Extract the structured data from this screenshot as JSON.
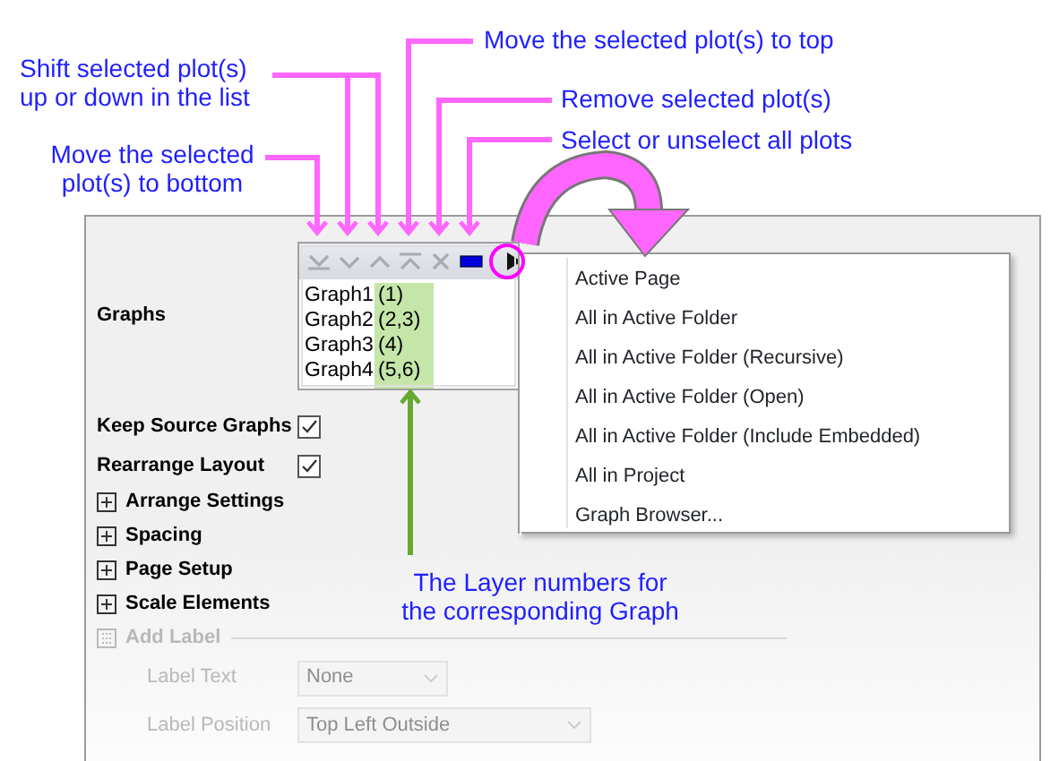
{
  "callouts": [
    {
      "kind": "shift",
      "text": "Shift selected plot(s)\nup or down in the list"
    },
    {
      "kind": "bottom",
      "text": "Move the selected\nplot(s) to bottom"
    },
    {
      "kind": "top",
      "text": "Move the selected plot(s) to top"
    },
    {
      "kind": "remove",
      "text": "Remove selected plot(s)"
    },
    {
      "kind": "select",
      "text": "Select or unselect all plots"
    },
    {
      "kind": "layers",
      "text": "The Layer numbers for\n the corresponding Graph"
    }
  ],
  "dialog": {
    "graphs_label": "Graphs",
    "toolbar": [
      {
        "kind": "bottom",
        "disabled": true
      },
      {
        "kind": "down",
        "disabled": true
      },
      {
        "kind": "up",
        "disabled": true
      },
      {
        "kind": "top",
        "disabled": true
      },
      {
        "kind": "remove",
        "disabled": true
      },
      {
        "kind": "select",
        "disabled": false
      },
      {
        "kind": "more",
        "disabled": false
      }
    ],
    "graphs": [
      {
        "name": "Graph1",
        "layers": "(1)"
      },
      {
        "name": "Graph2",
        "layers": "(2,3)"
      },
      {
        "name": "Graph3",
        "layers": "(4)"
      },
      {
        "name": "Graph4",
        "layers": "(5,6)"
      }
    ],
    "rows": [
      {
        "kind": "check",
        "label": "Keep Source Graphs",
        "checked": true
      },
      {
        "kind": "check",
        "label": "Rearrange Layout",
        "checked": true
      },
      {
        "kind": "expander",
        "label": "Arrange Settings",
        "disabled": false
      },
      {
        "kind": "expander",
        "label": "Spacing",
        "disabled": false
      },
      {
        "kind": "expander",
        "label": "Page Setup",
        "disabled": false
      },
      {
        "kind": "expander",
        "label": "Scale Elements",
        "disabled": false
      },
      {
        "kind": "group",
        "label": "Add Label",
        "disabled": true
      },
      {
        "kind": "select",
        "label": "Label Text",
        "value": "None",
        "disabled": true
      },
      {
        "kind": "select",
        "label": "Label Position",
        "value": "Top Left Outside",
        "disabled": true
      }
    ]
  },
  "menu": [
    "Active Page",
    "All in Active Folder",
    "All in Active Folder (Recursive)",
    "All in Active Folder (Open)",
    "All in Active Folder (Include Embedded)",
    "All in Project",
    "Graph Browser..."
  ]
}
